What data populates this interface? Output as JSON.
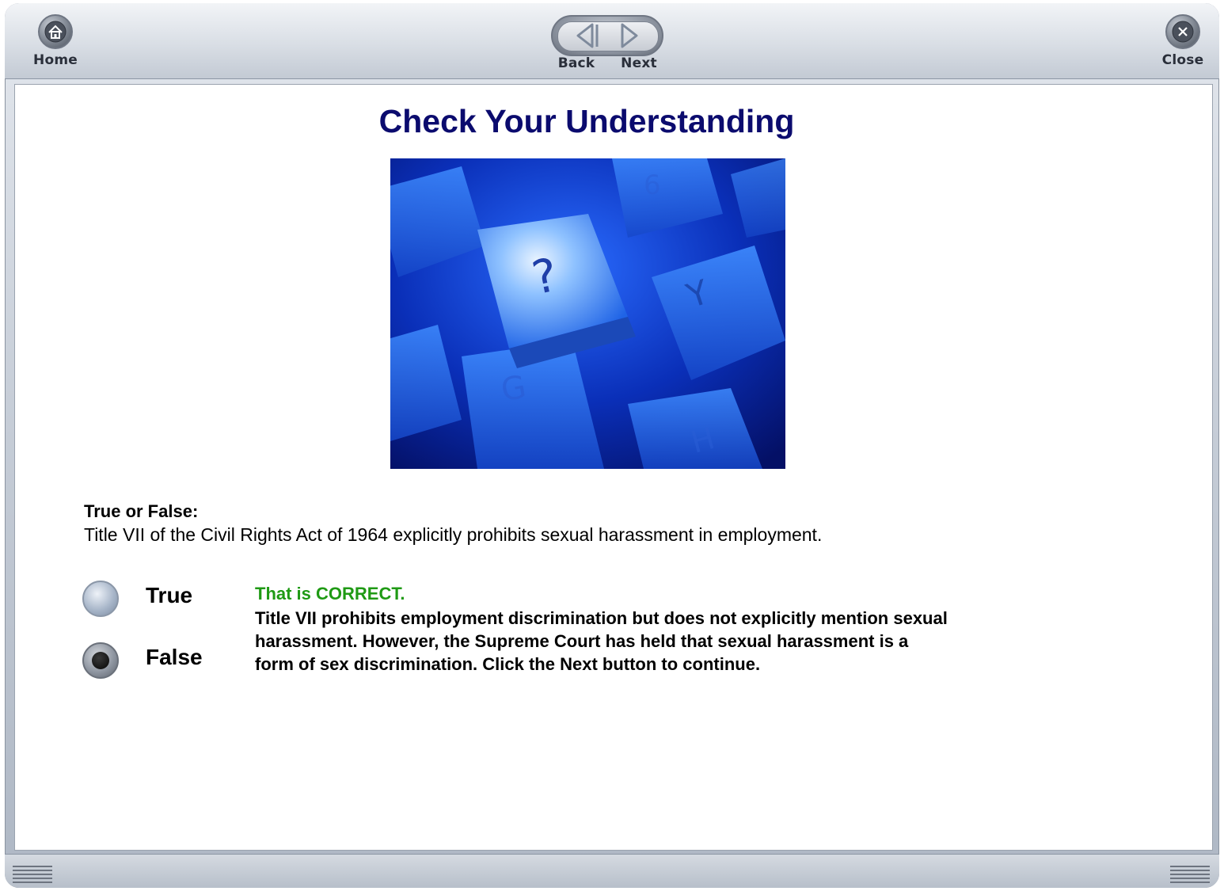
{
  "toolbar": {
    "home_label": "Home",
    "back_label": "Back",
    "next_label": "Next",
    "close_label": "Close"
  },
  "page": {
    "title": "Check Your Understanding",
    "question_label": "True or False:",
    "question_text": "Title VII of the Civil Rights Act of 1964 explicitly prohibits sexual harassment in employment."
  },
  "options": [
    {
      "label": "True",
      "selected": false
    },
    {
      "label": "False",
      "selected": true
    }
  ],
  "feedback": {
    "heading": "That is CORRECT.",
    "body": "Title VII prohibits employment discrimination but does not explicitly mention sexual harassment. However, the Supreme Court has held that sexual harassment is a form of sex discrimination. Click the Next button to continue."
  },
  "colors": {
    "title": "#0b0b6e",
    "correct": "#1f9a14"
  }
}
